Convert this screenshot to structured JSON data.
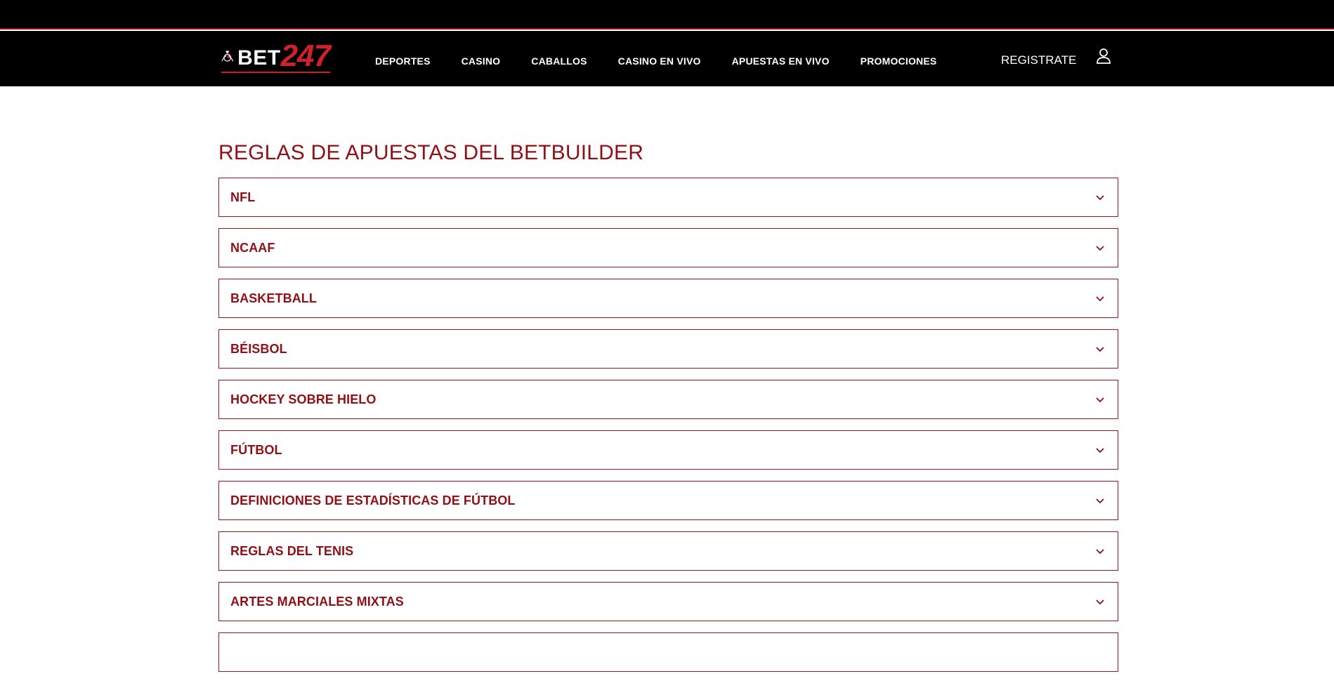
{
  "brand": {
    "name_text": "BET",
    "name_number": "247",
    "accent_color": "#d0202a",
    "title_color": "#8f1015"
  },
  "nav": {
    "items": [
      {
        "label": "DEPORTES"
      },
      {
        "label": "CASINO"
      },
      {
        "label": "CABALLOS"
      },
      {
        "label": "CASINO EN VIVO"
      },
      {
        "label": "APUESTAS EN VIVO"
      },
      {
        "label": "PROMOCIONES"
      }
    ],
    "register_label": "REGISTRATE",
    "account_icon": "user-icon"
  },
  "page": {
    "title": "REGLAS DE APUESTAS DEL BETBUILDER",
    "sections": [
      {
        "label": "NFL"
      },
      {
        "label": "NCAAF"
      },
      {
        "label": "BASKETBALL"
      },
      {
        "label": "BÉISBOL"
      },
      {
        "label": "HOCKEY SOBRE HIELO"
      },
      {
        "label": "FÚTBOL"
      },
      {
        "label": "DEFINICIONES DE ESTADÍSTICAS DE FÚTBOL"
      },
      {
        "label": "REGLAS DEL TENIS"
      },
      {
        "label": "ARTES MARCIALES MIXTAS"
      },
      {
        "label": ""
      }
    ]
  }
}
